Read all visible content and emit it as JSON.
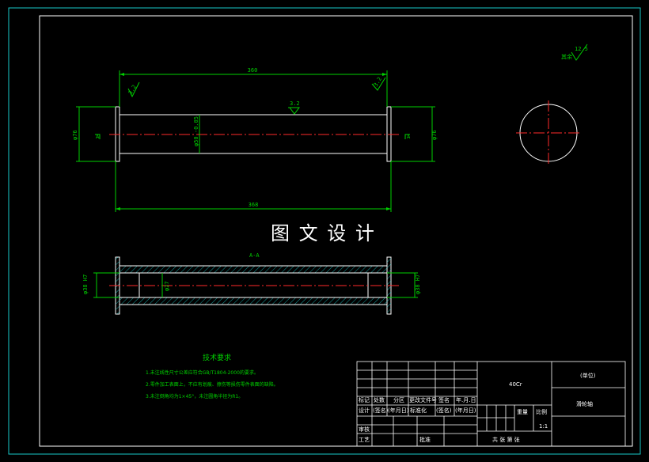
{
  "watermark": "图 文 设 计",
  "section_label": "A-A",
  "section_marker": "A",
  "dimensions": {
    "overall_length": "360",
    "total_length": "368",
    "flange_dia_left": "φ76",
    "flange_dia_right": "φ76",
    "shaft_dia": "φ50 -0.05",
    "inner_dia": "φ27",
    "bore_left": "φ38 H7",
    "bore_right": "φ38 H7"
  },
  "roughness": {
    "top_left": "3.2",
    "top_right": "3.2",
    "shaft": "3.2",
    "rest_value": "12.5",
    "rest_label": "其余"
  },
  "tech_requirements": {
    "title": "技术要求",
    "items": [
      "1.未注线性尺寸公差应符合GB/T1804-2000的要求。",
      "2.零件加工表面上，不应有划痕、擦伤等损伤零件表面的缺陷。",
      "3.未注倒角均为1×45°，未注圆角半径为R1。"
    ]
  },
  "title_block": {
    "material": "40Cr",
    "unit": "(单位)",
    "part_name": "滑轮轴",
    "r_biaoji": "标记",
    "r_chushu": "处数",
    "r_fenqu": "分区",
    "r_gengai": "更改文件号",
    "r_qianming": "签名",
    "r_date": "年.月.日",
    "r_sheji": "设计",
    "r_sig1": "(签名)",
    "r_date1": "(年月日)",
    "r_biaozhun": "标准化",
    "r_sig2": "(签名)",
    "r_date2": "(年月日)",
    "r_zhongliang": "重量",
    "r_bili": "比例",
    "scale_value": "1:1",
    "r_shenhe": "审核",
    "r_gongyi": "工艺",
    "r_pizhun": "批准",
    "r_sheets": "共  张  第  张"
  }
}
